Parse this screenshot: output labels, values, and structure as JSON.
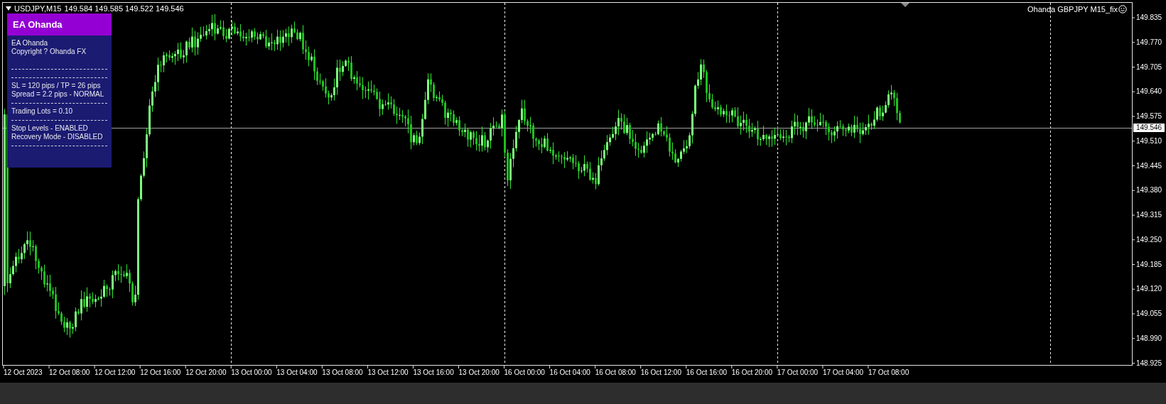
{
  "chart_header": {
    "symbol": "USDJPY,M15",
    "quotes": "149.584 149.585 149.522 149.546"
  },
  "ea_panel": {
    "title": "EA Ohanda",
    "lines": [
      {
        "kind": "text",
        "text": "EA Ohanda"
      },
      {
        "kind": "text",
        "text": "Copyright ? Ohanda FX"
      },
      {
        "kind": "gap"
      },
      {
        "kind": "rule"
      },
      {
        "kind": "rule"
      },
      {
        "kind": "text",
        "text": "SL = 120 pips / TP = 26 pips"
      },
      {
        "kind": "text",
        "text": "Spread = 2.2 pips - NORMAL"
      },
      {
        "kind": "rule"
      },
      {
        "kind": "text",
        "text": "Trading Lots = 0.10"
      },
      {
        "kind": "rule"
      },
      {
        "kind": "text",
        "text": "Stop Levels - ENABLED"
      },
      {
        "kind": "text",
        "text": "Recovery Mode - DISABLED"
      },
      {
        "kind": "rule"
      }
    ]
  },
  "indicator_label": "Ohanda GBPJPY M15_fix",
  "price_axis": [
    "149.835",
    "149.770",
    "149.705",
    "149.640",
    "149.575",
    "149.510",
    "149.445",
    "149.380",
    "149.315",
    "149.250",
    "149.185",
    "149.120",
    "149.055",
    "148.990",
    "148.925"
  ],
  "current_price": "149.546",
  "time_axis": [
    "12 Oct 2023",
    "12 Oct 08:00",
    "12 Oct 12:00",
    "12 Oct 16:00",
    "12 Oct 20:00",
    "13 Oct 00:00",
    "13 Oct 04:00",
    "13 Oct 08:00",
    "13 Oct 12:00",
    "13 Oct 16:00",
    "13 Oct 20:00",
    "16 Oct 00:00",
    "16 Oct 04:00",
    "16 Oct 08:00",
    "16 Oct 12:00",
    "16 Oct 16:00",
    "16 Oct 20:00",
    "17 Oct 00:00",
    "17 Oct 04:00",
    "17 Oct 08:00"
  ]
}
